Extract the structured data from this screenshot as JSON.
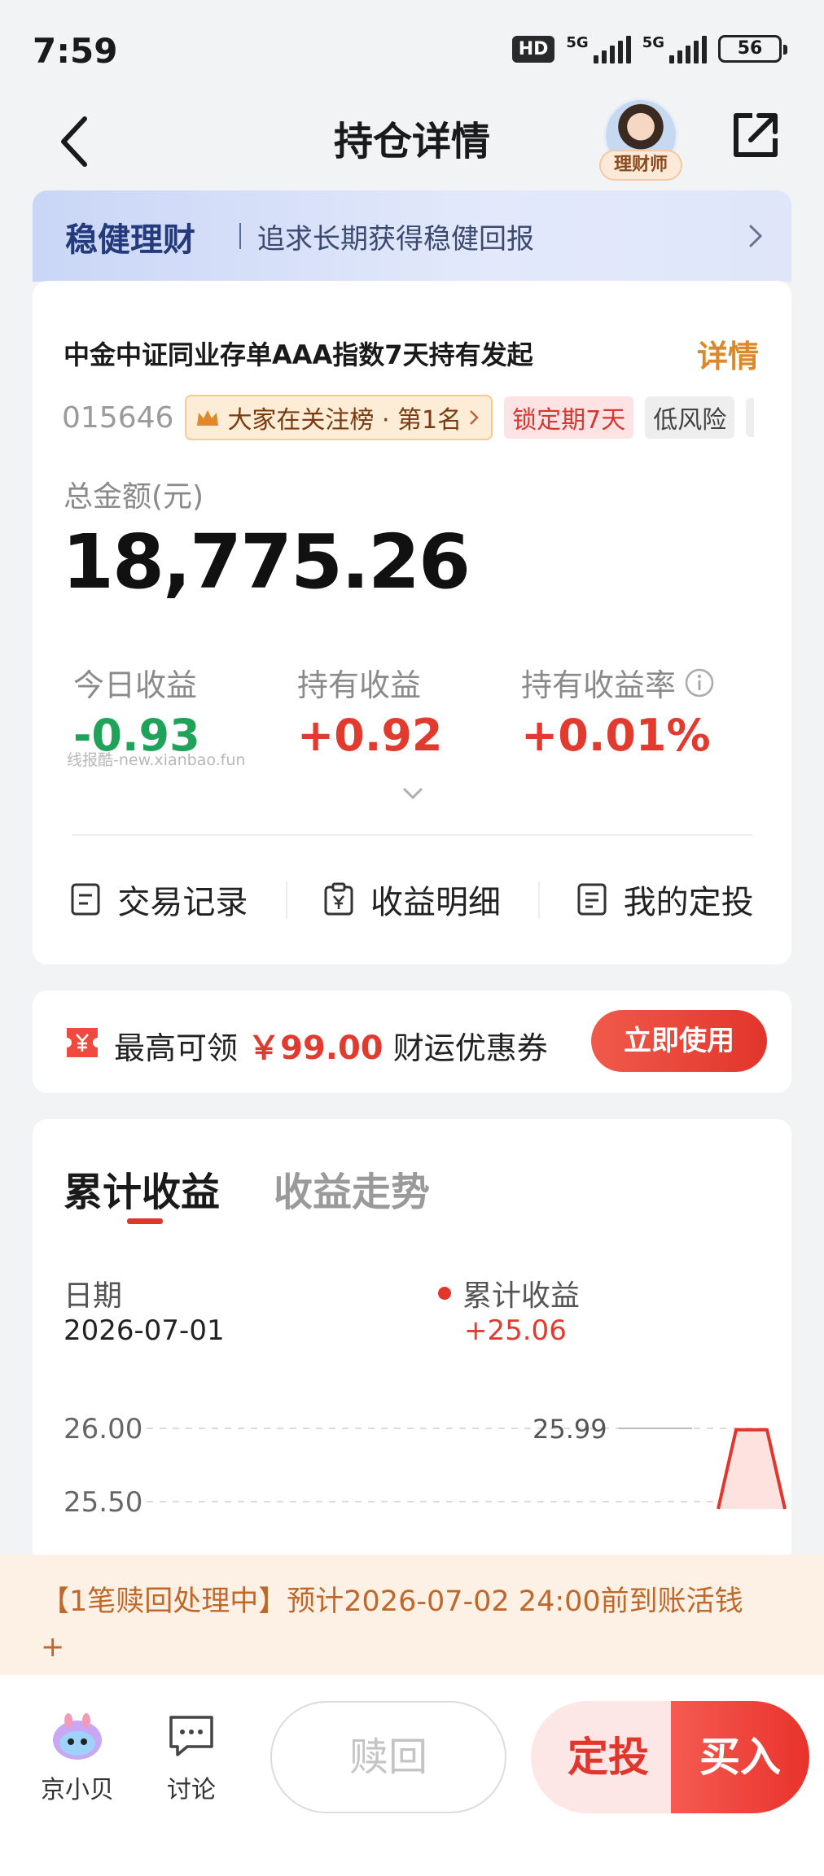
{
  "status_bar": {
    "time": "7:59",
    "hd_label": "HD",
    "network_1": "5G",
    "network_2": "5G",
    "battery": "56"
  },
  "nav": {
    "title": "持仓详情",
    "advisor_label": "理财师"
  },
  "banner": {
    "title": "稳健理财",
    "subtitle": "追求长期获得稳健回报"
  },
  "fund": {
    "name": "中金中证同业存单AAA指数7天持有发起",
    "detail_link": "详情",
    "code": "015646",
    "rank_tag": "大家在关注榜 · 第1名",
    "lock_tag": "锁定期7天",
    "risk_tag": "低风险"
  },
  "holding": {
    "total_label": "总金额(元)",
    "total_value": "18,775.26",
    "today_label": "今日收益",
    "today_value": "-0.93",
    "hold_label": "持有收益",
    "hold_value": "+0.92",
    "rate_label": "持有收益率",
    "rate_value": "+0.01%",
    "watermark": "线报酷-new.xianbao.fun"
  },
  "actions": {
    "trade_record": "交易记录",
    "income_detail": "收益明细",
    "my_plan": "我的定投"
  },
  "coupon": {
    "prefix": "最高可领",
    "amount": "￥99.00",
    "suffix": "财运优惠券",
    "button": "立即使用"
  },
  "chart_section": {
    "tab_active": "累计收益",
    "tab_inactive": "收益走势",
    "date_label": "日期",
    "date_value": "2026-07-01",
    "legend_label": "累计收益",
    "legend_value": "+25.06",
    "accent_color": "#e2352c"
  },
  "chart_data": {
    "type": "line",
    "ytick_labels": [
      "26.00",
      "25.50"
    ],
    "peak_label": "25.99",
    "series": [
      {
        "values": [
          25.45,
          25.99,
          25.99,
          25.45
        ]
      }
    ]
  },
  "notice": {
    "text": "【1笔赎回处理中】预计2026-07-02 24:00前到账活钱",
    "extra": "+"
  },
  "bottom_bar": {
    "assistant": "京小贝",
    "discuss": "讨论",
    "redeem": "赎回",
    "plan": "定投",
    "buy": "买入"
  }
}
